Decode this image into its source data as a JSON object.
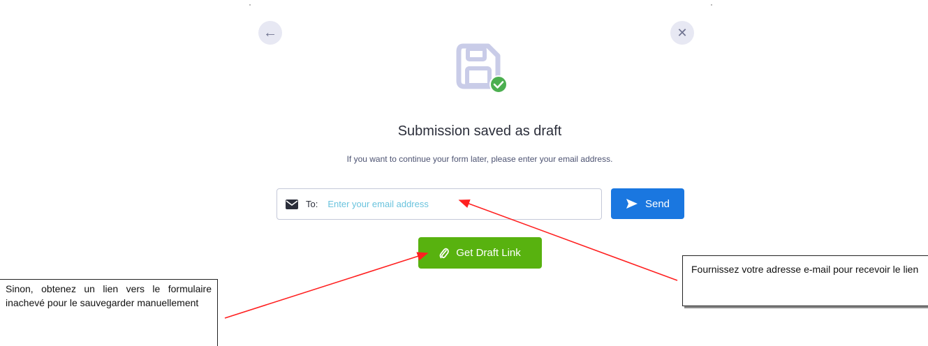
{
  "header": {
    "back_icon": "arrow-left-icon",
    "close_icon": "close-icon",
    "back_glyph": "←",
    "close_glyph": "✕"
  },
  "status": {
    "icon": "floppy-disk-saved-icon",
    "title": "Submission saved as draft",
    "subtitle": "If you want to continue your form later, please enter your email address."
  },
  "email_form": {
    "icon": "envelope-icon",
    "to_label": "To:",
    "placeholder": "Enter your email address",
    "value": "",
    "send_label": "Send",
    "send_icon": "paper-plane-icon"
  },
  "draft_link": {
    "label": "Get Draft Link",
    "icon": "paperclip-icon"
  },
  "annotations": {
    "left_note": "Sinon, obtenez un lien vers le formulaire inachevé pour le sauvegarder manuellement",
    "right_note": "Fournissez votre adresse e-mail pour recevoir le lien"
  },
  "colors": {
    "send_button": "#1a77e0",
    "draft_button": "#58b20f",
    "success_check": "#4caf50",
    "icon_tint": "#c9cce8",
    "annotation_arrow": "#ff2020"
  }
}
